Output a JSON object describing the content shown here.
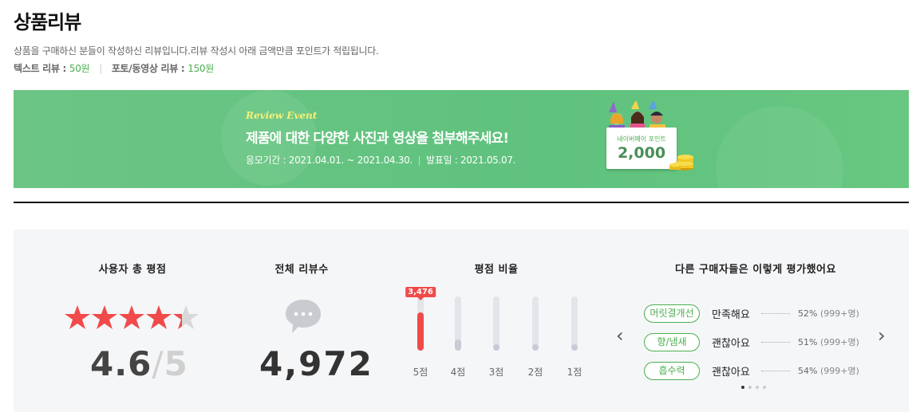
{
  "title": "상품리뷰",
  "description": "상품을 구매하신 분들이 작성하신 리뷰입니다.리뷰 작성시 아래 금액만큼 포인트가 적립됩니다.",
  "points": {
    "text_label": "텍스트 리뷰 :",
    "text_value": "50원",
    "photo_label": "포토/동영상 리뷰 :",
    "photo_value": "150원"
  },
  "banner": {
    "event_label": "Review Event",
    "headline": "제품에 대한 다양한 사진과 영상을 첨부해주세요!",
    "period": "응모기간 : 2021.04.01. ~ 2021.04.30.",
    "announce": "발표일 : 2021.05.07.",
    "card_title": "네이버페이 포인트",
    "card_value": "2,000"
  },
  "summary": {
    "rating_title": "사용자 총 평점",
    "rating_value": "4.6",
    "rating_max": "5",
    "rating": 4.6,
    "total_title": "전체 리뷰수",
    "total_value": "4,972",
    "ratio_title": "평점 비율",
    "ratio_bars": [
      {
        "label": "5점",
        "fraction": 0.7,
        "count": "3,476",
        "top": true
      },
      {
        "label": "4점",
        "fraction": 0.21,
        "count": "",
        "top": false
      },
      {
        "label": "3점",
        "fraction": 0.06,
        "count": "",
        "top": false
      },
      {
        "label": "2점",
        "fraction": 0.02,
        "count": "",
        "top": false
      },
      {
        "label": "1점",
        "fraction": 0.02,
        "count": "",
        "top": false
      }
    ],
    "others_title": "다른 구매자들은 이렇게 평가했어요",
    "attributes": [
      {
        "tag": "머릿결개선",
        "value": "만족해요",
        "percent": "52%",
        "count": "(999+명)"
      },
      {
        "tag": "향/냄새",
        "value": "괜찮아요",
        "percent": "51%",
        "count": "(999+명)"
      },
      {
        "tag": "흡수력",
        "value": "괜찮아요",
        "percent": "54%",
        "count": "(999+명)"
      }
    ],
    "prev_icon": "chevron-left-icon",
    "next_icon": "chevron-right-icon"
  },
  "colors": {
    "accent_green": "#4caf50",
    "star_red": "#f04a4a",
    "banner_green": "#62c37f"
  }
}
